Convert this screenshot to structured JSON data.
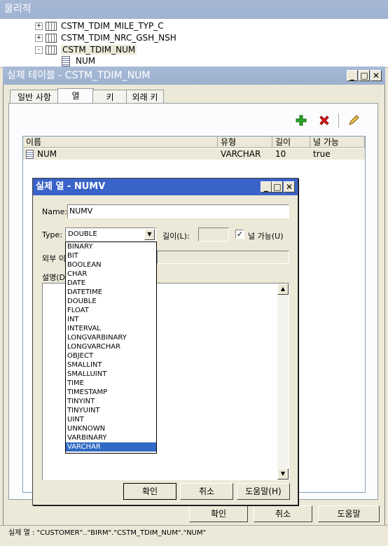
{
  "panel": {
    "title": "물리적"
  },
  "tree": {
    "items": [
      {
        "label": "CSTM_TDIM_MILE_TYP_C",
        "expander": "+"
      },
      {
        "label": "CSTM_TDIM_NRC_GSH_NSH",
        "expander": "+"
      },
      {
        "label": "CSTM_TDIM_NUM",
        "expander": "-"
      }
    ],
    "child": "NUM"
  },
  "outer_dialog": {
    "title": "실제 테이블 - CSTM_TDIM_NUM",
    "tabs": [
      "일반 사항",
      "열",
      "키",
      "외래 키"
    ],
    "active_tab": "열",
    "columns": [
      "이름",
      "유형",
      "길이",
      "널 가능"
    ],
    "rows": [
      {
        "name": "NUM",
        "type": "VARCHAR",
        "length": "10",
        "nullable": "true"
      }
    ],
    "buttons": {
      "ok": "확인",
      "cancel": "취소",
      "help": "도움말"
    }
  },
  "inner_dialog": {
    "title": "실제 열 - NUMV",
    "name_label": "Name:",
    "name_value": "NUMV",
    "type_label": "Type:",
    "type_value": "DOUBLE",
    "length_label": "길이(L):",
    "nullable_label": "널 가능(U)",
    "nullable_checked": true,
    "external_label": "외부 이",
    "description_label": "설명(D",
    "type_options": [
      "BINARY",
      "BIT",
      "BOOLEAN",
      "CHAR",
      "DATE",
      "DATETIME",
      "DOUBLE",
      "FLOAT",
      "INT",
      "INTERVAL",
      "LONGVARBINARY",
      "LONGVARCHAR",
      "OBJECT",
      "SMALLINT",
      "SMALLUINT",
      "TIME",
      "TIMESTAMP",
      "TINYINT",
      "TINYUINT",
      "UINT",
      "UNKNOWN",
      "VARBINARY",
      "VARCHAR"
    ],
    "selected_option": "VARCHAR",
    "buttons": {
      "ok": "확인",
      "cancel": "취소",
      "help": "도움말(H)"
    }
  },
  "status_bar": {
    "text": "실제 열 : \"CUSTOMER\"..\"BIRM\".\"CSTM_TDIM_NUM\".\"NUM\""
  },
  "colors": {
    "inner_title": "#3a63c9",
    "selection": "#316ac5",
    "outer_title": "#a8bad6"
  }
}
